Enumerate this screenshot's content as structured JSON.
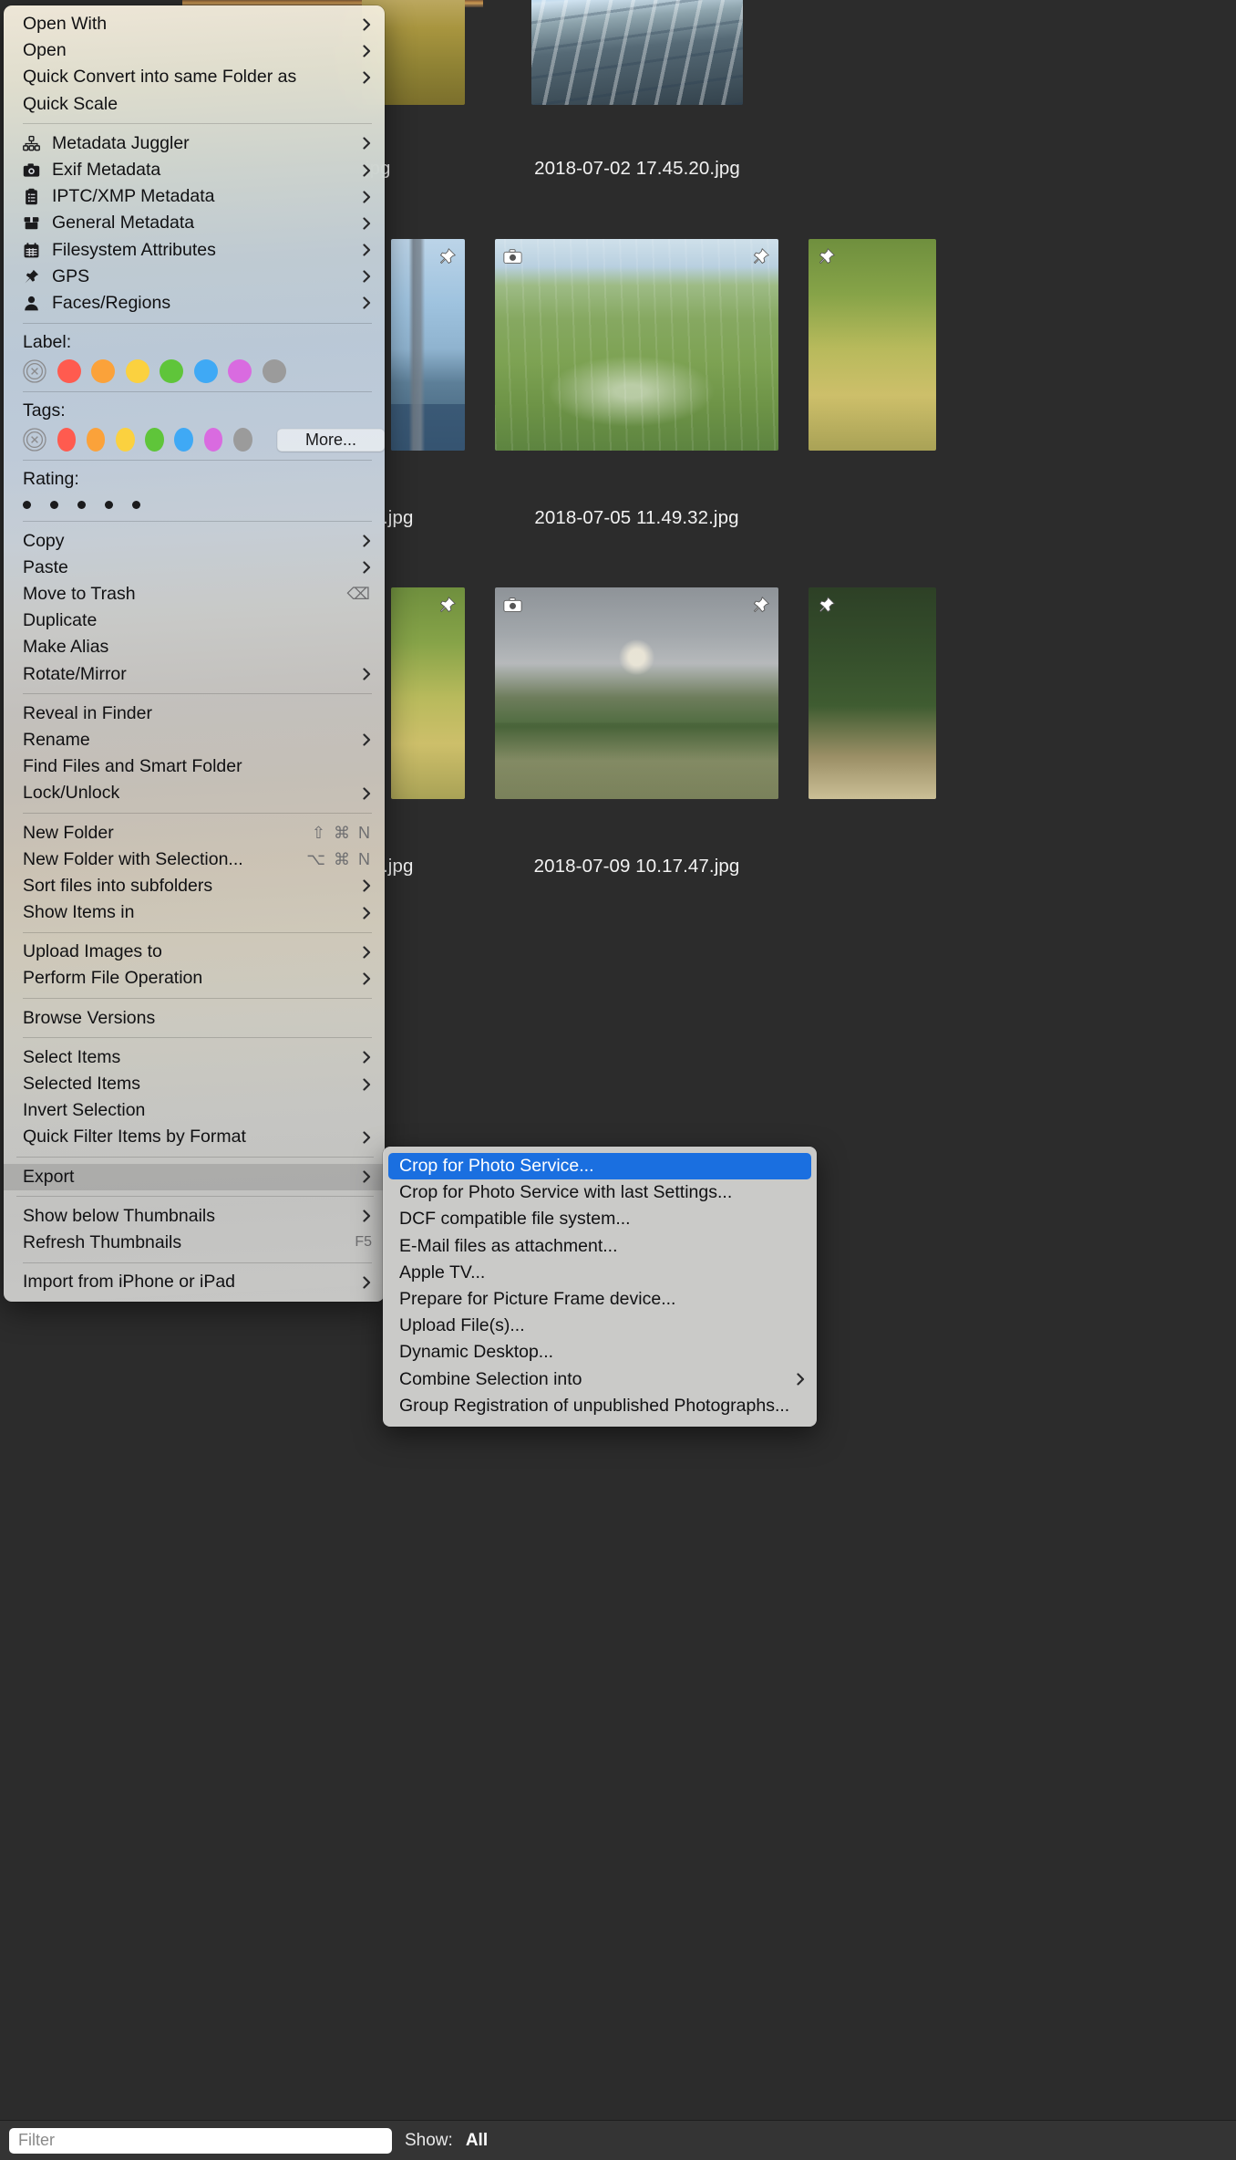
{
  "app": {
    "window_background": "#2c2c2c",
    "menu_highlight_color": "#1a6fe0"
  },
  "browser": {
    "photos": [
      {
        "filename": "2018-07-02 17.45.20.jpg",
        "style": "ph-scaffold",
        "badges": []
      },
      {
        "filename": "2018-07-05 11.49.32.jpg",
        "style": "ph-hill",
        "badges": [
          "camera-icon",
          "pin-icon"
        ]
      },
      {
        "filename": "2018-07-09 10.17.47.jpg",
        "style": "ph-castle",
        "badges": [
          "camera-icon",
          "pin-icon"
        ]
      },
      {
        "filename": ".jpg",
        "style": "ph-bridge",
        "badges": [
          "pin-icon"
        ]
      },
      {
        "filename": ".jpg",
        "style": "ph-grass",
        "badges": [
          "pin-icon"
        ]
      },
      {
        "filename": ".jpg",
        "style": "ph-hedge",
        "badges": [
          "pin-icon"
        ]
      }
    ]
  },
  "statusbar": {
    "filter_placeholder": "Filter",
    "filter_value": "",
    "show_label": "Show:",
    "show_value": "All"
  },
  "context_menu": {
    "groups": [
      {
        "items": [
          {
            "label": "Open With",
            "icon": null,
            "submenu": true,
            "shortcut": null
          },
          {
            "label": "Open",
            "icon": null,
            "submenu": true,
            "shortcut": null
          },
          {
            "label": "Quick Convert into same Folder as",
            "icon": null,
            "submenu": true,
            "shortcut": null
          },
          {
            "label": "Quick Scale",
            "icon": null,
            "submenu": false,
            "shortcut": null
          }
        ]
      },
      {
        "items": [
          {
            "label": "Metadata Juggler",
            "icon": "juggler-icon",
            "submenu": true,
            "shortcut": null
          },
          {
            "label": "Exif Metadata",
            "icon": "camera-icon",
            "submenu": true,
            "shortcut": null
          },
          {
            "label": "IPTC/XMP Metadata",
            "icon": "clipboard-icon",
            "submenu": true,
            "shortcut": null
          },
          {
            "label": "General Metadata",
            "icon": "box-icon",
            "submenu": true,
            "shortcut": null
          },
          {
            "label": "Filesystem Attributes",
            "icon": "calendar-icon",
            "submenu": true,
            "shortcut": null
          },
          {
            "label": "GPS",
            "icon": "pin-icon",
            "submenu": true,
            "shortcut": null
          },
          {
            "label": "Faces/Regions",
            "icon": "person-icon",
            "submenu": true,
            "shortcut": null
          }
        ]
      }
    ],
    "label_section": {
      "title": "Label:",
      "swatches": [
        "none",
        "#ff5b4f",
        "#fba23a",
        "#fbd13f",
        "#5fc53a",
        "#3fa9f5",
        "#d96be0",
        "#9b9b9b"
      ]
    },
    "tags_section": {
      "title": "Tags:",
      "swatches": [
        "none",
        "#ff5b4f",
        "#fba23a",
        "#fbd13f",
        "#5fc53a",
        "#3fa9f5",
        "#d96be0",
        "#9b9b9b"
      ],
      "more_label": "More..."
    },
    "rating_section": {
      "title": "Rating:",
      "dots": 5
    },
    "groups2": [
      {
        "items": [
          {
            "label": "Copy",
            "submenu": true,
            "shortcut": null
          },
          {
            "label": "Paste",
            "submenu": true,
            "shortcut": null
          },
          {
            "label": "Move to Trash",
            "submenu": false,
            "shortcut": "⌫"
          },
          {
            "label": "Duplicate",
            "submenu": false,
            "shortcut": null
          },
          {
            "label": "Make Alias",
            "submenu": false,
            "shortcut": null
          },
          {
            "label": "Rotate/Mirror",
            "submenu": true,
            "shortcut": null
          }
        ]
      },
      {
        "items": [
          {
            "label": "Reveal in Finder",
            "submenu": false,
            "shortcut": null
          },
          {
            "label": "Rename",
            "submenu": true,
            "shortcut": null
          },
          {
            "label": "Find Files and Smart Folder",
            "submenu": false,
            "shortcut": null
          },
          {
            "label": "Lock/Unlock",
            "submenu": true,
            "shortcut": null
          }
        ]
      },
      {
        "items": [
          {
            "label": "New Folder",
            "submenu": false,
            "shortcut": "⇧ ⌘ N"
          },
          {
            "label": "New Folder with Selection...",
            "submenu": false,
            "shortcut": "⌥ ⌘ N"
          },
          {
            "label": "Sort files into subfolders",
            "submenu": true,
            "shortcut": null
          },
          {
            "label": "Show Items in",
            "submenu": true,
            "shortcut": null
          }
        ]
      },
      {
        "items": [
          {
            "label": "Upload Images to",
            "submenu": true,
            "shortcut": null
          },
          {
            "label": "Perform File Operation",
            "submenu": true,
            "shortcut": null
          }
        ]
      },
      {
        "items": [
          {
            "label": "Browse Versions",
            "submenu": false,
            "shortcut": null
          }
        ]
      },
      {
        "items": [
          {
            "label": "Select Items",
            "submenu": true,
            "shortcut": null
          },
          {
            "label": "Selected Items",
            "submenu": true,
            "shortcut": null
          },
          {
            "label": "Invert Selection",
            "submenu": false,
            "shortcut": null
          },
          {
            "label": "Quick Filter Items by Format",
            "submenu": true,
            "shortcut": null
          }
        ]
      },
      {
        "items": [
          {
            "label": "Export",
            "submenu": true,
            "shortcut": null,
            "selected": true
          }
        ]
      },
      {
        "items": [
          {
            "label": "Show below Thumbnails",
            "submenu": true,
            "shortcut": null
          },
          {
            "label": "Refresh Thumbnails",
            "submenu": false,
            "shortcut": "F5"
          }
        ]
      },
      {
        "items": [
          {
            "label": "Import from iPhone or iPad",
            "submenu": true,
            "shortcut": null
          }
        ]
      }
    ]
  },
  "export_submenu": {
    "items": [
      {
        "label": "Crop for Photo Service...",
        "submenu": false,
        "highlight": true
      },
      {
        "label": "Crop for Photo Service with last Settings...",
        "submenu": false,
        "highlight": false
      },
      {
        "label": "DCF compatible file system...",
        "submenu": false,
        "highlight": false
      },
      {
        "label": "E-Mail files as attachment...",
        "submenu": false,
        "highlight": false
      },
      {
        "label": "Apple TV...",
        "submenu": false,
        "highlight": false
      },
      {
        "label": "Prepare for Picture Frame device...",
        "submenu": false,
        "highlight": false
      },
      {
        "label": "Upload File(s)...",
        "submenu": false,
        "highlight": false
      },
      {
        "label": "Dynamic Desktop...",
        "submenu": false,
        "highlight": false
      },
      {
        "label": "Combine Selection into",
        "submenu": true,
        "highlight": false
      },
      {
        "label": "Group Registration of unpublished Photographs...",
        "submenu": false,
        "highlight": false
      }
    ]
  }
}
